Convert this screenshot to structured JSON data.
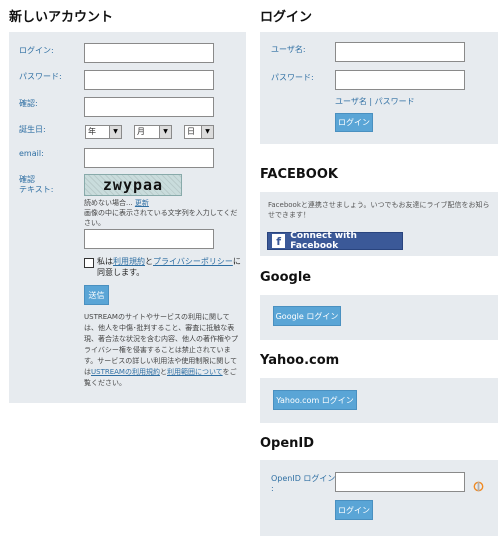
{
  "new_account": {
    "title": "新しいアカウント",
    "login_label": "ログイン:",
    "password_label": "パスワード:",
    "confirm_label": "確認:",
    "birthday_label": "誕生日:",
    "year": "年",
    "month": "月",
    "day": "日",
    "email_label": "email:",
    "confirm_text_label_1": "確認",
    "confirm_text_label_2": "テキスト:",
    "captcha_text": "zwypaa",
    "unreadable": "読めない場合...",
    "refresh_link": "更新",
    "captcha_instruction": "画像の中に表示されている文字列を入力してください。",
    "terms_prefix": "私は",
    "terms_link": "利用規約",
    "terms_and": "と",
    "privacy_link": "プライバシーポリシー",
    "terms_suffix": "に同意します。",
    "submit": "送信",
    "notice_text": "USTREAMのサイトやサービスの利用に関しては、他人を中傷･批判すること、審査に抵触な表現、著合法な状況を含む内容、他人の著作権やプライバシー権を侵害することは禁止されています。サービスの詳しい利用法や使用制限に関しては",
    "notice_link_1": "USTREAMの利用規約",
    "notice_and": "と",
    "notice_link_2": "利用範囲について",
    "notice_suffix": "をご覧ください。"
  },
  "login": {
    "title": "ログイン",
    "username_label": "ユーザ名:",
    "password_label": "パスワード:",
    "username_link": "ユーザ名",
    "separator": " | ",
    "password_link": "パスワード",
    "button": "ログイン"
  },
  "facebook": {
    "title": "FACEBOOK",
    "description": "Facebookと連携させましょう。いつでもお友達にライブ配信をお知らせできます！",
    "connect_label": "Connect with Facebook",
    "icon_letter": "f"
  },
  "google": {
    "title": "Google",
    "button": "Google ログイン"
  },
  "yahoo": {
    "title": "Yahoo.com",
    "button": "Yahoo.com ログイン"
  },
  "openid": {
    "title": "OpenID",
    "label_1": "OpenID ログイン",
    "label_2": ":",
    "button": "ログイン"
  }
}
